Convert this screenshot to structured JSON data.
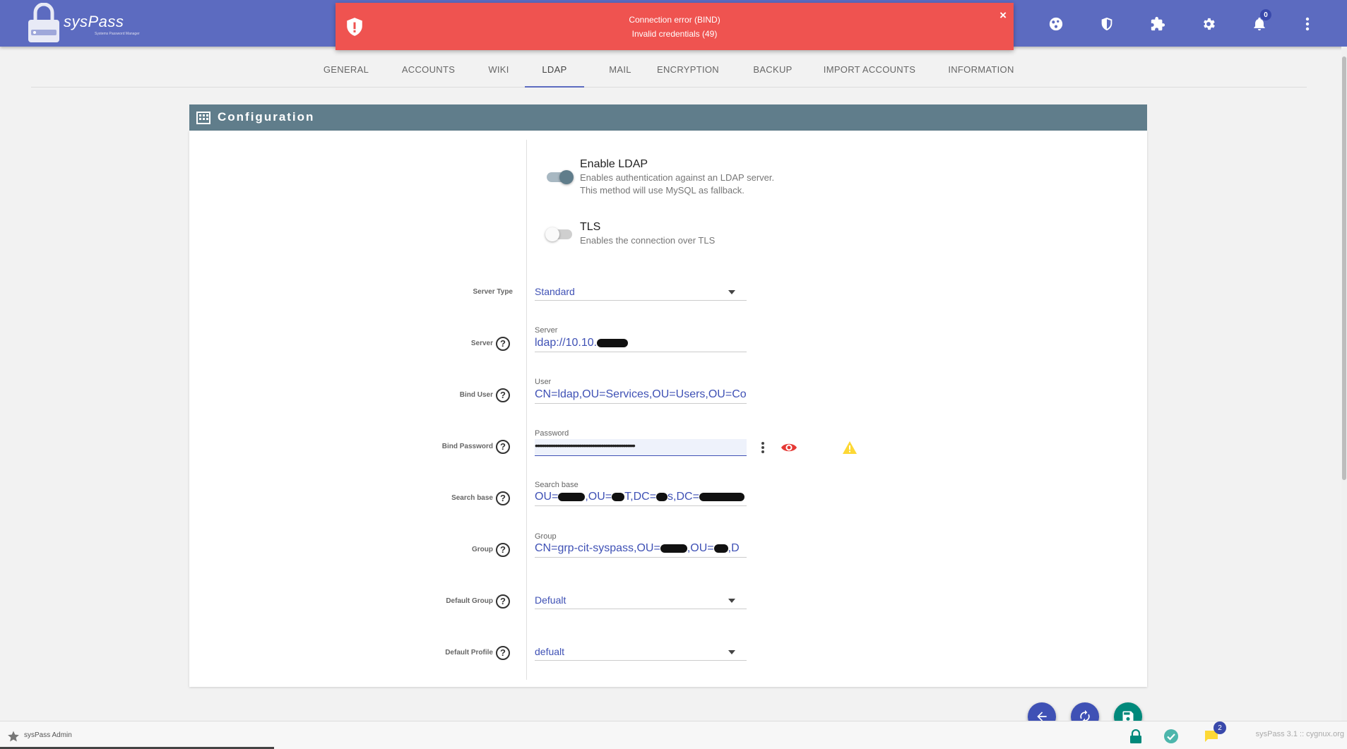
{
  "app": {
    "name": "sysPass",
    "subtitle": "Systems Password Manager"
  },
  "header": {
    "icons": [
      "globe-icon",
      "shield-icon",
      "puzzle-icon",
      "gear-icon",
      "bell-icon",
      "more-vert-icon"
    ],
    "notifications_count": "0"
  },
  "toast": {
    "line1": "Connection error (BIND)",
    "line2": "Invalid credentials (49)",
    "close": "×",
    "color": "#ef5350"
  },
  "tabs": [
    {
      "label": "GENERAL"
    },
    {
      "label": "ACCOUNTS"
    },
    {
      "label": "WIKI"
    },
    {
      "label": "LDAP",
      "active": true
    },
    {
      "label": "MAIL"
    },
    {
      "label": "ENCRYPTION"
    },
    {
      "label": "BACKUP"
    },
    {
      "label": "IMPORT ACCOUNTS"
    },
    {
      "label": "INFORMATION"
    }
  ],
  "panel": {
    "title": "Configuration"
  },
  "switches": {
    "ldap": {
      "title": "Enable LDAP",
      "desc1": "Enables authentication against an LDAP server.",
      "desc2": "This method will use MySQL as fallback.",
      "on": true
    },
    "tls": {
      "title": "TLS",
      "desc": "Enables the connection over TLS",
      "on": false
    }
  },
  "form": {
    "server_type": {
      "label": "Server Type",
      "value": "Standard"
    },
    "server": {
      "label": "Server",
      "field_label": "Server",
      "value": "ldap://10.10."
    },
    "bind_user": {
      "label": "Bind User",
      "field_label": "User",
      "value": "CN=ldap,OU=Services,OU=Users,OU=Co"
    },
    "bind_password": {
      "label": "Bind Password",
      "field_label": "Password",
      "value": "••••••••••••••••••••••••••••••••••••••••••••••••••••••"
    },
    "search_base": {
      "label": "Search base",
      "field_label": "Search base",
      "v1": "OU=",
      "v2": ",OU=",
      "v3": "T,DC=",
      "v4": "s,DC="
    },
    "group": {
      "label": "Group",
      "field_label": "Group",
      "v1": "CN=grp-cit-syspass,OU=",
      "v2": ",OU=",
      "v3": ",D"
    },
    "default_group": {
      "label": "Default Group",
      "value": "Defualt"
    },
    "default_profile": {
      "label": "Default Profile",
      "value": "defualt"
    },
    "help_glyph": "?"
  },
  "fabs": [
    "back-icon",
    "refresh-icon",
    "save-icon"
  ],
  "footer": {
    "user": "sysPass Admin",
    "version": "sysPass 3.1  ::  cygnux.org",
    "messages_count": "2"
  },
  "colors": {
    "primary": "#5c6bc0",
    "panel": "#607d8b",
    "accent": "#3f51b5",
    "green": "#00897b"
  }
}
